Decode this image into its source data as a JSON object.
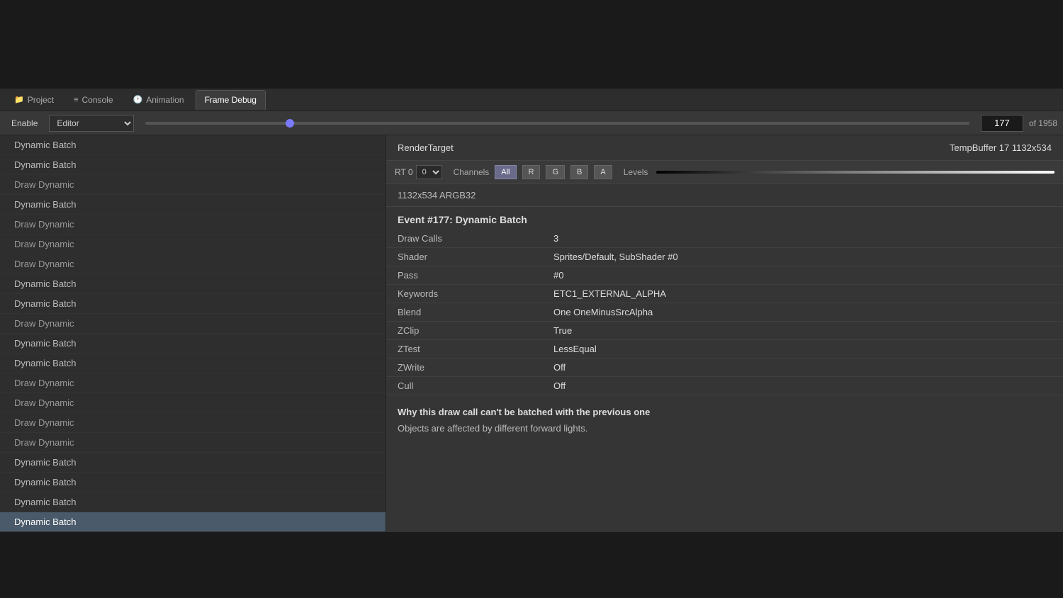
{
  "topbar": {
    "height": 125
  },
  "tabs": [
    {
      "id": "project",
      "icon": "📁",
      "label": "Project",
      "active": false
    },
    {
      "id": "console",
      "icon": "📋",
      "label": "Console",
      "active": false
    },
    {
      "id": "animation",
      "icon": "🕐",
      "label": "Animation",
      "active": false
    },
    {
      "id": "framedebug",
      "icon": "",
      "label": "Frame Debug",
      "active": true
    }
  ],
  "toolbar": {
    "enable_label": "Enable",
    "editor_label": "Editor",
    "frame_current": "177",
    "frame_total": "of 1958"
  },
  "event_list": {
    "items": [
      {
        "label": "Dynamic Batch",
        "type": "dynamic-batch",
        "selected": false
      },
      {
        "label": "Dynamic Batch",
        "type": "dynamic-batch",
        "selected": false
      },
      {
        "label": "Draw Dynamic",
        "type": "draw-dynamic",
        "selected": false
      },
      {
        "label": "Dynamic Batch",
        "type": "dynamic-batch",
        "selected": false
      },
      {
        "label": "Draw Dynamic",
        "type": "draw-dynamic",
        "selected": false
      },
      {
        "label": "Draw Dynamic",
        "type": "draw-dynamic",
        "selected": false
      },
      {
        "label": "Draw Dynamic",
        "type": "draw-dynamic",
        "selected": false
      },
      {
        "label": "Dynamic Batch",
        "type": "dynamic-batch",
        "selected": false
      },
      {
        "label": "Dynamic Batch",
        "type": "dynamic-batch",
        "selected": false
      },
      {
        "label": "Draw Dynamic",
        "type": "draw-dynamic",
        "selected": false
      },
      {
        "label": "Dynamic Batch",
        "type": "dynamic-batch",
        "selected": false
      },
      {
        "label": "Dynamic Batch",
        "type": "dynamic-batch",
        "selected": false
      },
      {
        "label": "Draw Dynamic",
        "type": "draw-dynamic",
        "selected": false
      },
      {
        "label": "Draw Dynamic",
        "type": "draw-dynamic",
        "selected": false
      },
      {
        "label": "Draw Dynamic",
        "type": "draw-dynamic",
        "selected": false
      },
      {
        "label": "Draw Dynamic",
        "type": "draw-dynamic",
        "selected": false
      },
      {
        "label": "Dynamic Batch",
        "type": "dynamic-batch",
        "selected": false
      },
      {
        "label": "Dynamic Batch",
        "type": "dynamic-batch",
        "selected": false
      },
      {
        "label": "Dynamic Batch",
        "type": "dynamic-batch",
        "selected": false
      },
      {
        "label": "Dynamic Batch",
        "type": "dynamic-batch",
        "selected": true
      }
    ]
  },
  "detail": {
    "render_target_label": "RenderTarget",
    "render_target_value": "TempBuffer 17 1132x534",
    "rt_label": "RT 0",
    "channels_label": "Channels",
    "channel_buttons": [
      "All",
      "R",
      "G",
      "B",
      "A"
    ],
    "active_channel": "All",
    "levels_label": "Levels",
    "resolution": "1132x534 ARGB32",
    "event_title": "Event #177: Dynamic Batch",
    "properties": [
      {
        "key": "Draw Calls",
        "value": "3"
      },
      {
        "key": "Shader",
        "value": "Sprites/Default, SubShader #0"
      },
      {
        "key": "Pass",
        "value": "#0"
      },
      {
        "key": "Keywords",
        "value": "ETC1_EXTERNAL_ALPHA"
      },
      {
        "key": "Blend",
        "value": "One OneMinusSrcAlpha"
      },
      {
        "key": "ZClip",
        "value": "True"
      },
      {
        "key": "ZTest",
        "value": "LessEqual"
      },
      {
        "key": "ZWrite",
        "value": "Off"
      },
      {
        "key": "Cull",
        "value": "Off"
      }
    ],
    "batch_reason_title": "Why this draw call can't be batched with the previous one",
    "batch_reason_desc": "Objects are affected by different forward lights."
  }
}
